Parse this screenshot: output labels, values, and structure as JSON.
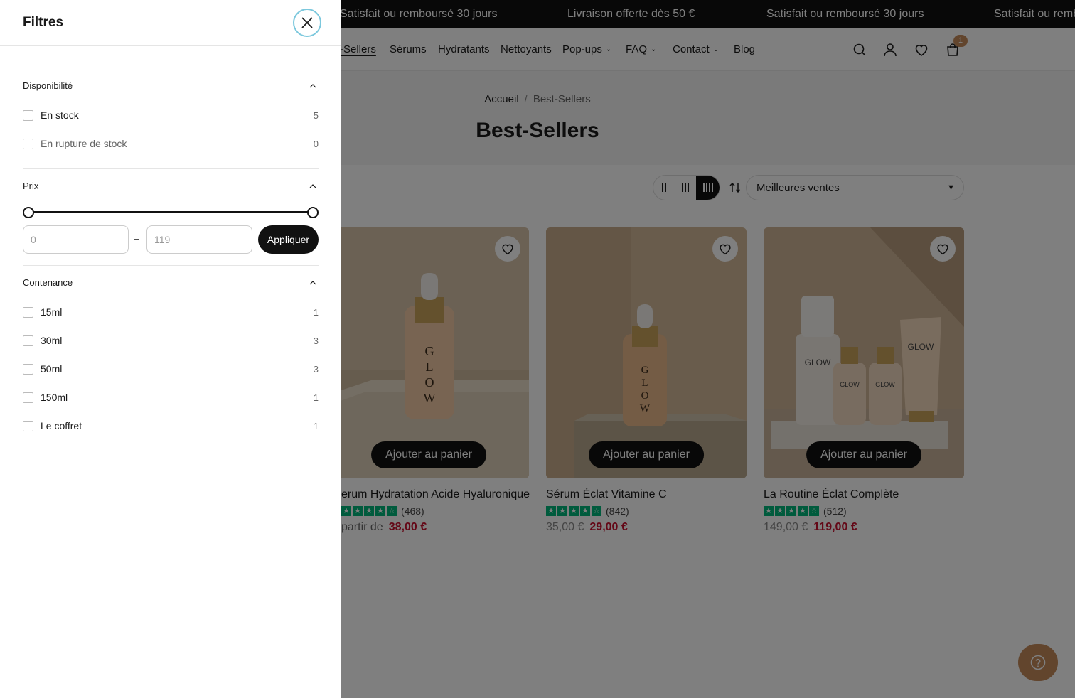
{
  "announcement": {
    "messages": [
      "Satisfait ou remboursé 30 jours",
      "Livraison offerte dès 50 €",
      "Satisfait ou remboursé 30 jours",
      "Satisfait ou remb"
    ]
  },
  "nav": {
    "items": [
      {
        "label": "-Sellers"
      },
      {
        "label": "Sérums"
      },
      {
        "label": "Hydratants"
      },
      {
        "label": "Nettoyants"
      },
      {
        "label": "Pop-ups"
      },
      {
        "label": "FAQ"
      },
      {
        "label": "Contact"
      },
      {
        "label": "Blog"
      }
    ],
    "cart_count": "1"
  },
  "breadcrumb": {
    "home": "Accueil",
    "separator": "/",
    "current": "Best-Sellers"
  },
  "page_title": "Best-Sellers",
  "sort": {
    "selected": "Meilleures ventes"
  },
  "products": [
    {
      "title": "erum Hydratation Acide Hyaluronique",
      "reviews": "(468)",
      "price_prefix": "partir de",
      "old_price": "",
      "price": "38,00 €",
      "rating": 4.5,
      "add_to_cart": "Ajouter au panier"
    },
    {
      "title": "Sérum Éclat Vitamine C",
      "reviews": "(842)",
      "price_prefix": "",
      "old_price": "35,00 €",
      "price": "29,00 €",
      "rating": 4.5,
      "add_to_cart": "Ajouter au panier"
    },
    {
      "title": "La Routine Éclat Complète",
      "reviews": "(512)",
      "price_prefix": "",
      "old_price": "149,00 €",
      "price": "119,00 €",
      "rating": 4.5,
      "add_to_cart": "Ajouter au panier"
    }
  ],
  "drawer": {
    "title": "Filtres",
    "availability": {
      "heading": "Disponibilité",
      "options": [
        {
          "label": "En stock",
          "count": "5"
        },
        {
          "label": "En rupture de stock",
          "count": "0"
        }
      ]
    },
    "price": {
      "heading": "Prix",
      "min_placeholder": "0",
      "max_placeholder": "119",
      "separator": "–",
      "apply_label": "Appliquer"
    },
    "capacity": {
      "heading": "Contenance",
      "options": [
        {
          "label": "15ml",
          "count": "1"
        },
        {
          "label": "30ml",
          "count": "3"
        },
        {
          "label": "50ml",
          "count": "3"
        },
        {
          "label": "150ml",
          "count": "1"
        },
        {
          "label": "Le coffret",
          "count": "1"
        }
      ]
    }
  },
  "colors": {
    "accent": "#c48a5a",
    "sale": "#c8102e",
    "rating": "#00b67a",
    "focus_ring": "#7cc8dd"
  }
}
